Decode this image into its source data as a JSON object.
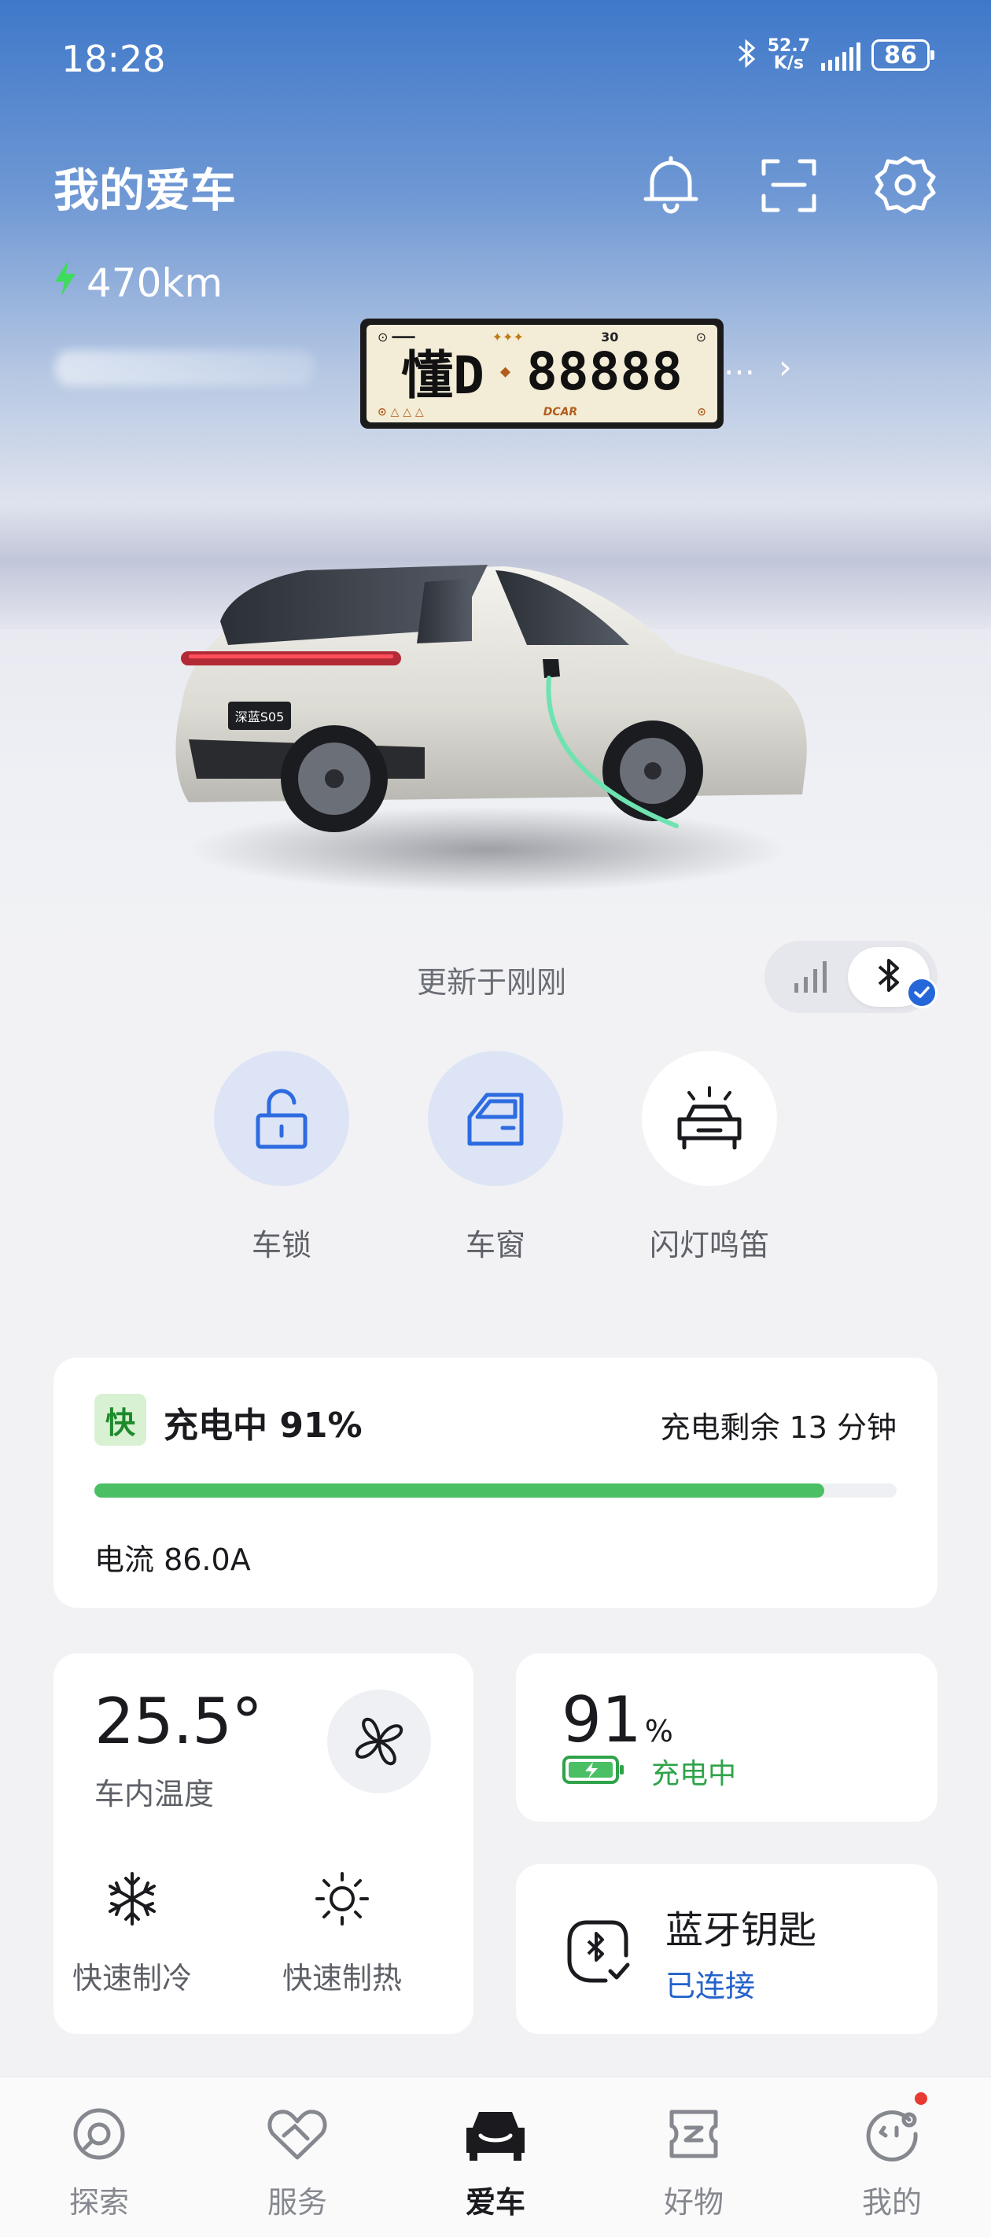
{
  "status_bar": {
    "time": "18:28",
    "net_speed_value": "52.7",
    "net_speed_unit": "K/s",
    "battery_level": "86"
  },
  "header": {
    "title": "我的爱车",
    "range": "470km"
  },
  "license_plate": {
    "province": "懂D",
    "number": "88888",
    "brand": "DCAR",
    "top_number": "30"
  },
  "status": {
    "updated_text": "更新于刚刚"
  },
  "quick_actions": [
    {
      "label": "车锁",
      "icon": "unlock-icon"
    },
    {
      "label": "车窗",
      "icon": "window-icon"
    },
    {
      "label": "闪灯鸣笛",
      "icon": "car-flash-icon"
    }
  ],
  "charging": {
    "badge": "快",
    "status": "充电中 91%",
    "remaining": "充电剩余 13 分钟",
    "progress": 0.91,
    "current": "电流 86.0A",
    "bar_color": "#4bbf63"
  },
  "climate": {
    "temperature": "25.5°",
    "temperature_label": "车内温度",
    "cool_label": "快速制冷",
    "heat_label": "快速制热"
  },
  "battery_card": {
    "soc": "91",
    "soc_unit": "%",
    "status": "充电中"
  },
  "bluetooth_key": {
    "title": "蓝牙钥匙",
    "status": "已连接"
  },
  "bottom_nav": [
    {
      "label": "探索",
      "icon": "explore-icon",
      "active": false
    },
    {
      "label": "服务",
      "icon": "service-icon",
      "active": false
    },
    {
      "label": "爱车",
      "icon": "car-icon",
      "active": true
    },
    {
      "label": "好物",
      "icon": "shop-icon",
      "active": false
    },
    {
      "label": "我的",
      "icon": "profile-icon",
      "active": false
    }
  ],
  "colors": {
    "accent_blue": "#2567d8",
    "charging_green": "#4bbf63",
    "header_blue": "#3f78c9"
  }
}
